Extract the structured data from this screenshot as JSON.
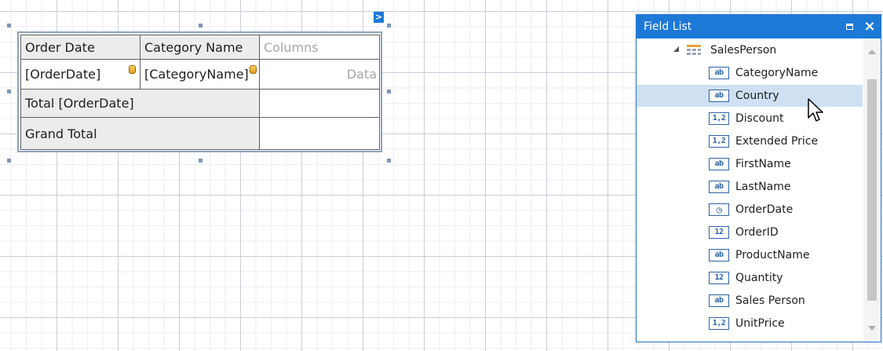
{
  "pivot_grid": {
    "header_cells": [
      "Order Date",
      "Category Name",
      "Columns"
    ],
    "data_row_cells": [
      "[OrderDate]",
      "[CategoryName]",
      "Data"
    ],
    "total_row_label": "Total [OrderDate]",
    "grand_total_label": "Grand Total"
  },
  "smart_tag": {
    "glyph": ">"
  },
  "field_list": {
    "title": "Field List",
    "data_source": "SalesPerson",
    "fields": [
      {
        "type_icon": "ab",
        "type": "string",
        "name": "CategoryName"
      },
      {
        "type_icon": "ab",
        "type": "string",
        "name": "Country",
        "selected": true
      },
      {
        "type_icon": "1,2",
        "type": "decimal",
        "name": "Discount"
      },
      {
        "type_icon": "1,2",
        "type": "decimal",
        "name": "Extended Price"
      },
      {
        "type_icon": "ab",
        "type": "string",
        "name": "FirstName"
      },
      {
        "type_icon": "ab",
        "type": "string",
        "name": "LastName"
      },
      {
        "type_icon": "◷",
        "type": "date",
        "name": "OrderDate"
      },
      {
        "type_icon": "12",
        "type": "integer",
        "name": "OrderID"
      },
      {
        "type_icon": "ab",
        "type": "string",
        "name": "ProductName"
      },
      {
        "type_icon": "12",
        "type": "integer",
        "name": "Quantity"
      },
      {
        "type_icon": "ab",
        "type": "string",
        "name": "Sales Person"
      },
      {
        "type_icon": "1,2",
        "type": "decimal",
        "name": "UnitPrice"
      }
    ]
  },
  "colors": {
    "panel_header": "#1c79d6",
    "selection": "#cfe0f2",
    "field_icon": "#2c63a6"
  }
}
